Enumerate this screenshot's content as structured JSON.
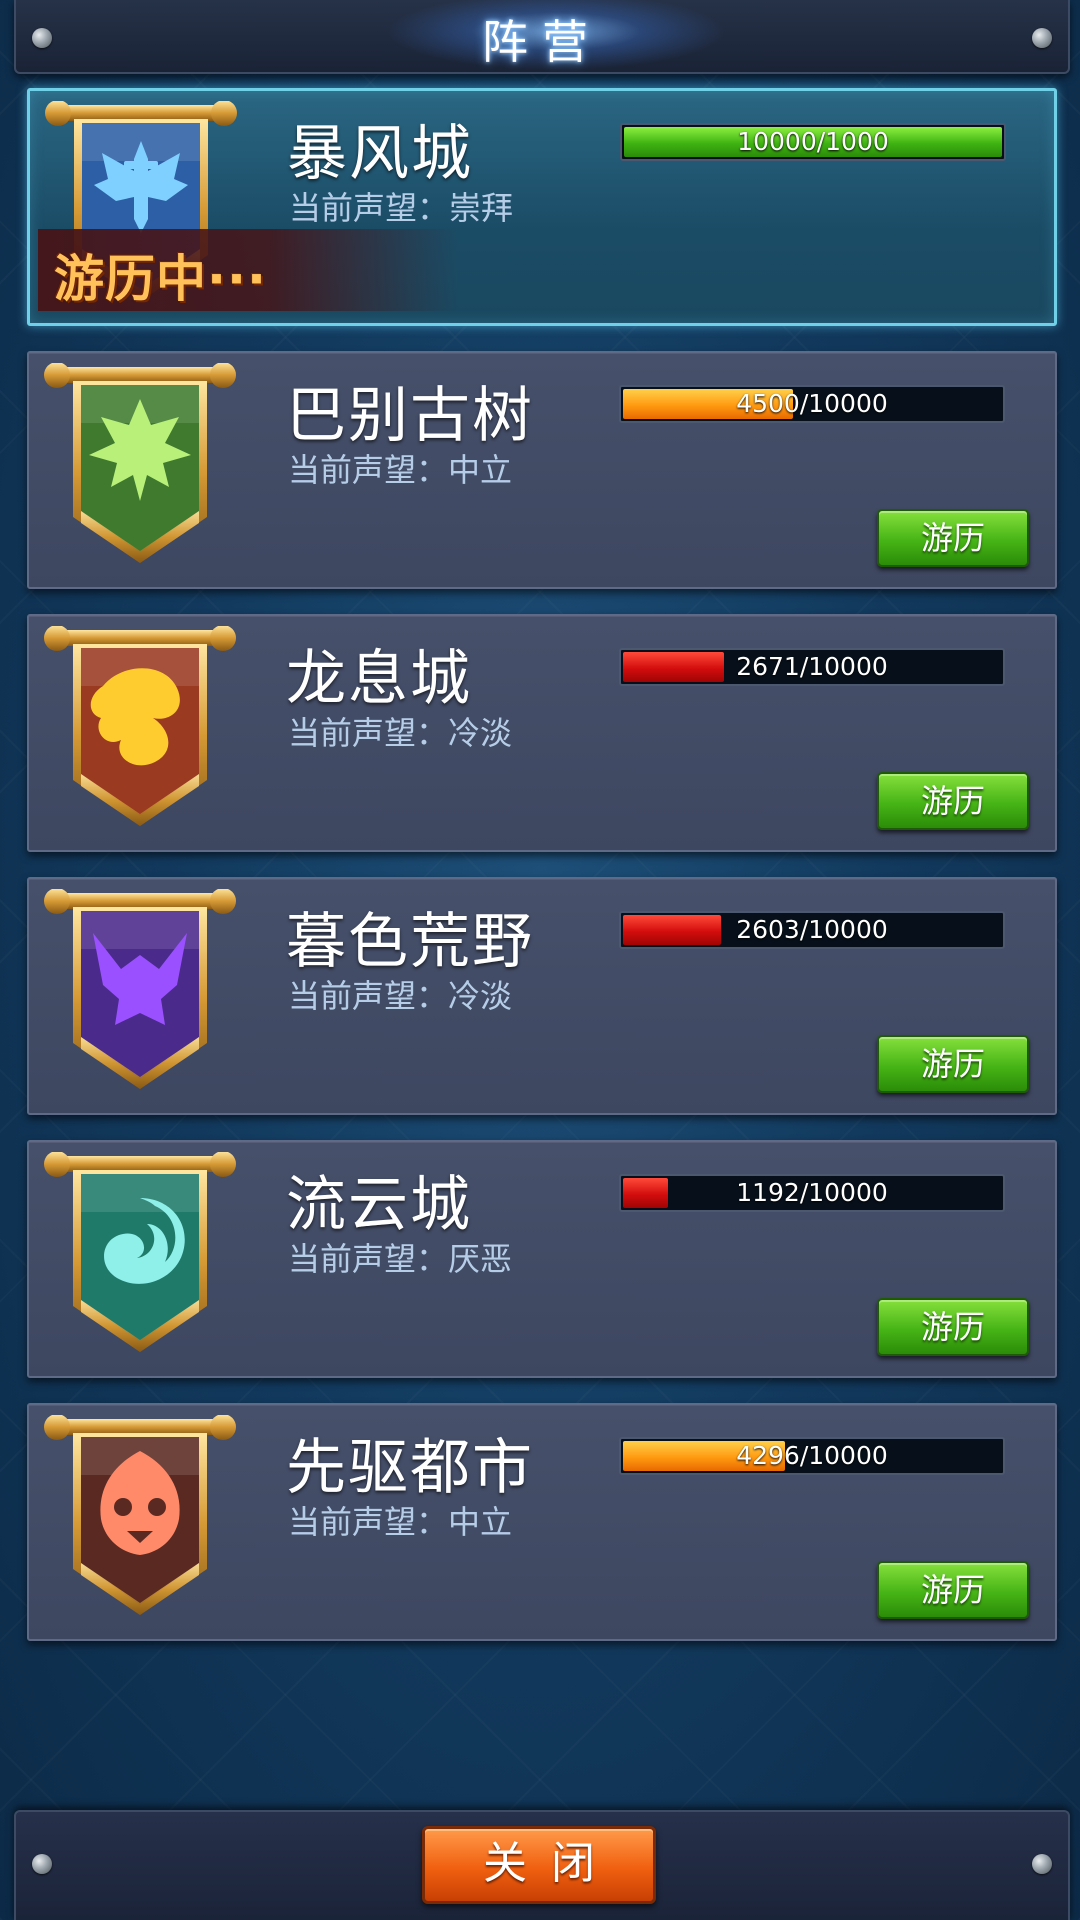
{
  "header": {
    "title": "阵营"
  },
  "factions": [
    {
      "name": "暴风城",
      "reputation": "当前声望：崇拜",
      "progress_text": "10000/1000",
      "progress": 1.0,
      "bar_color": "green",
      "state": "traveling",
      "status_label": "游历中···",
      "emblem_icon": "storm-sword-icon",
      "banner_color": "#2d5fa6",
      "symbol_color": "#7fd0ff"
    },
    {
      "name": "巴别古树",
      "reputation": "当前声望：中立",
      "progress_text": "4500/10000",
      "progress": 0.45,
      "bar_color": "orange",
      "state": "idle",
      "button_label": "游历",
      "emblem_icon": "leaf-icon",
      "banner_color": "#3f7a2e",
      "symbol_color": "#b8f07a"
    },
    {
      "name": "龙息城",
      "reputation": "当前声望：冷淡",
      "progress_text": "2671/10000",
      "progress": 0.2671,
      "bar_color": "red",
      "state": "idle",
      "button_label": "游历",
      "emblem_icon": "dragon-icon",
      "banner_color": "#9a3a20",
      "symbol_color": "#ffcc30"
    },
    {
      "name": "暮色荒野",
      "reputation": "当前声望：冷淡",
      "progress_text": "2603/10000",
      "progress": 0.2603,
      "bar_color": "red",
      "state": "idle",
      "button_label": "游历",
      "emblem_icon": "demon-icon",
      "banner_color": "#4a2a8a",
      "symbol_color": "#9a50ff"
    },
    {
      "name": "流云城",
      "reputation": "当前声望：厌恶",
      "progress_text": "1192/10000",
      "progress": 0.1192,
      "bar_color": "red",
      "state": "idle",
      "button_label": "游历",
      "emblem_icon": "wave-icon",
      "banner_color": "#1f7a6a",
      "symbol_color": "#8ff0ea"
    },
    {
      "name": "先驱都市",
      "reputation": "当前声望：中立",
      "progress_text": "4296/10000",
      "progress": 0.4296,
      "bar_color": "orange",
      "state": "idle",
      "button_label": "游历",
      "emblem_icon": "mask-icon",
      "banner_color": "#5a2a22",
      "symbol_color": "#ff8a6a"
    }
  ],
  "footer": {
    "close_label": "关闭"
  }
}
